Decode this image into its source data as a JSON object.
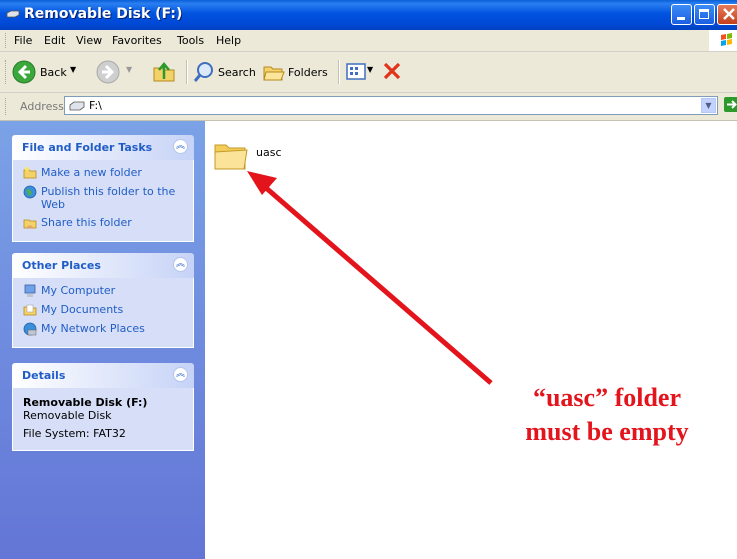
{
  "window": {
    "title": "Removable Disk (F:)"
  },
  "menu": [
    "File",
    "Edit",
    "View",
    "Favorites",
    "Tools",
    "Help"
  ],
  "toolbar": {
    "back": "Back",
    "search": "Search",
    "folders": "Folders"
  },
  "address": {
    "label": "Address",
    "value": "F:\\",
    "go": "Go"
  },
  "tasks": {
    "title": "File and Folder Tasks",
    "items": [
      "Make a new folder",
      "Publish this folder to the Web",
      "Share this folder"
    ]
  },
  "places": {
    "title": "Other Places",
    "items": [
      "My Computer",
      "My Documents",
      "My Network Places"
    ]
  },
  "details": {
    "title": "Details",
    "name": "Removable Disk (F:)",
    "type": "Removable Disk",
    "fs": "File System: FAT32"
  },
  "files": [
    {
      "name": "uasc",
      "icon": "folder-icon"
    }
  ],
  "annotation": {
    "line1": "“uasc” folder",
    "line2": "must be empty",
    "color": "#e3141c"
  },
  "colors": {
    "titlebar": "#0053e0",
    "sidebar": "#7ba2e7",
    "link": "#215dc6"
  }
}
